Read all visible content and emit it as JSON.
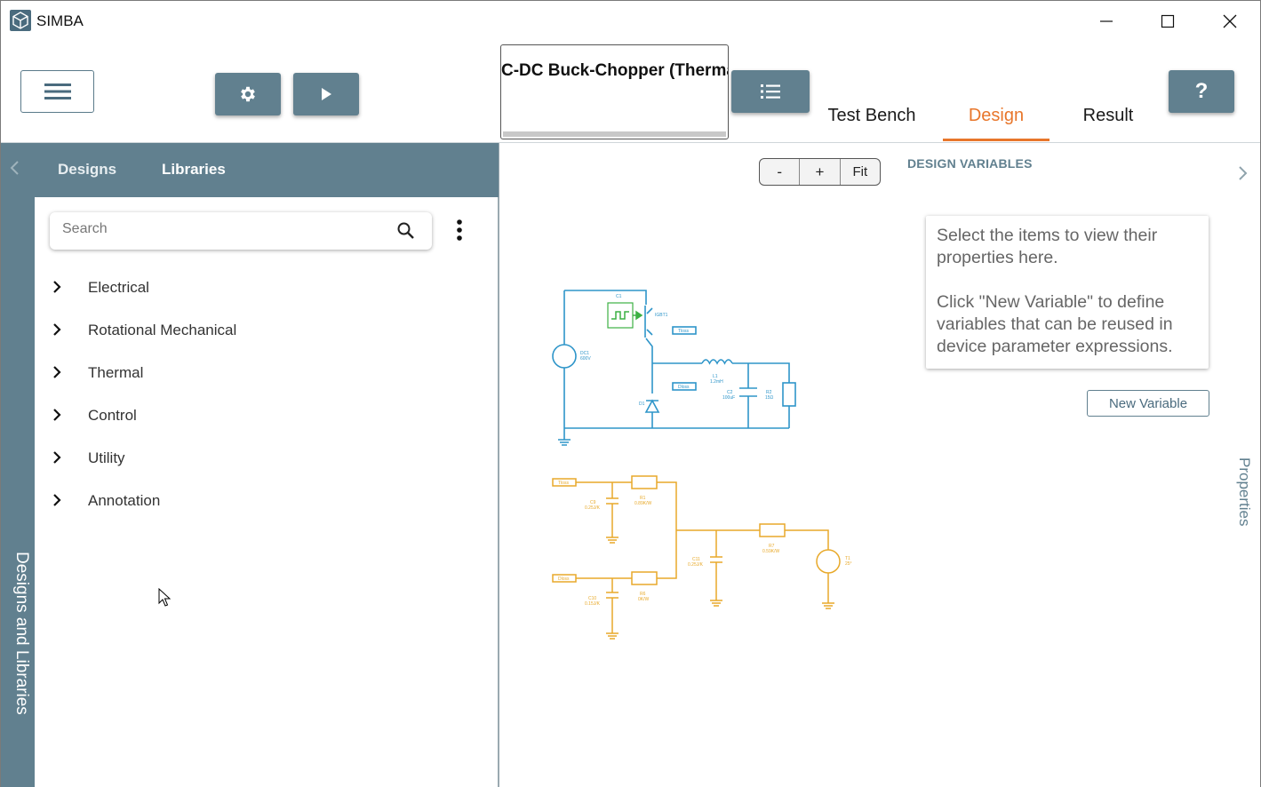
{
  "app": {
    "title": "SIMBA"
  },
  "window_controls": [
    "minimize",
    "maximize",
    "close"
  ],
  "toolbar": {
    "menu_icon": "hamburger-icon",
    "settings_icon": "gear-icon",
    "run_icon": "play-icon",
    "design_name": "C-DC Buck-Chopper (Therma",
    "list_icon": "list-icon",
    "help_label": "?"
  },
  "tabs": [
    {
      "label": "Test Bench",
      "active": false
    },
    {
      "label": "Design",
      "active": true
    },
    {
      "label": "Result",
      "active": false
    }
  ],
  "left_panel": {
    "rail_label": "Designs and Libraries",
    "tabs": [
      {
        "label": "Designs",
        "active": false
      },
      {
        "label": "Libraries",
        "active": true
      }
    ],
    "search": {
      "placeholder": "Search",
      "value": ""
    },
    "tree": [
      {
        "label": "Electrical"
      },
      {
        "label": "Rotational Mechanical"
      },
      {
        "label": "Thermal"
      },
      {
        "label": "Control"
      },
      {
        "label": "Utility"
      },
      {
        "label": "Annotation"
      }
    ]
  },
  "canvas": {
    "zoom_out": "-",
    "zoom_in": "+",
    "fit": "Fit",
    "electrical_labels": {
      "c1": "C1",
      "igbt": "IGBT1",
      "dc1": "DC1",
      "dc1_v": "600V",
      "l1": "L1",
      "l1_v": "1.2mH",
      "c2": "C2",
      "c2_v": "100uF",
      "r2": "R2",
      "r2_v": "15Ω",
      "d1": "D1",
      "tloss": "Tloss",
      "dloss": "Dloss"
    },
    "thermal_labels": {
      "tloss": "Tloss",
      "dloss": "Dloss",
      "c9": "C9",
      "c9_v": "0.25J/K",
      "r1": "R1",
      "r1_v": "0.89K/W",
      "r6": "R6",
      "r6_v": "0K/W",
      "c10": "C10",
      "c10_v": "0.15J/K",
      "c11": "C11",
      "c11_v": "0.25J/K",
      "r7": "R7",
      "r7_v": "0.59K/W",
      "t1": "T1",
      "t1_v": "25°"
    },
    "colors": {
      "electrical": "#2e95c9",
      "thermal": "#e8a92a",
      "control": "#3cb043"
    }
  },
  "design_variables": {
    "title": "DESIGN VARIABLES",
    "hint_line1": "Select the items to view their properties here.",
    "hint_line2": "Click \"New Variable\" to define variables that can be reused in device parameter expressions.",
    "new_variable_label": "New Variable"
  },
  "right_panel": {
    "rail_label": "Properties"
  },
  "accent": "#e8762b",
  "panel_color": "#61808f"
}
